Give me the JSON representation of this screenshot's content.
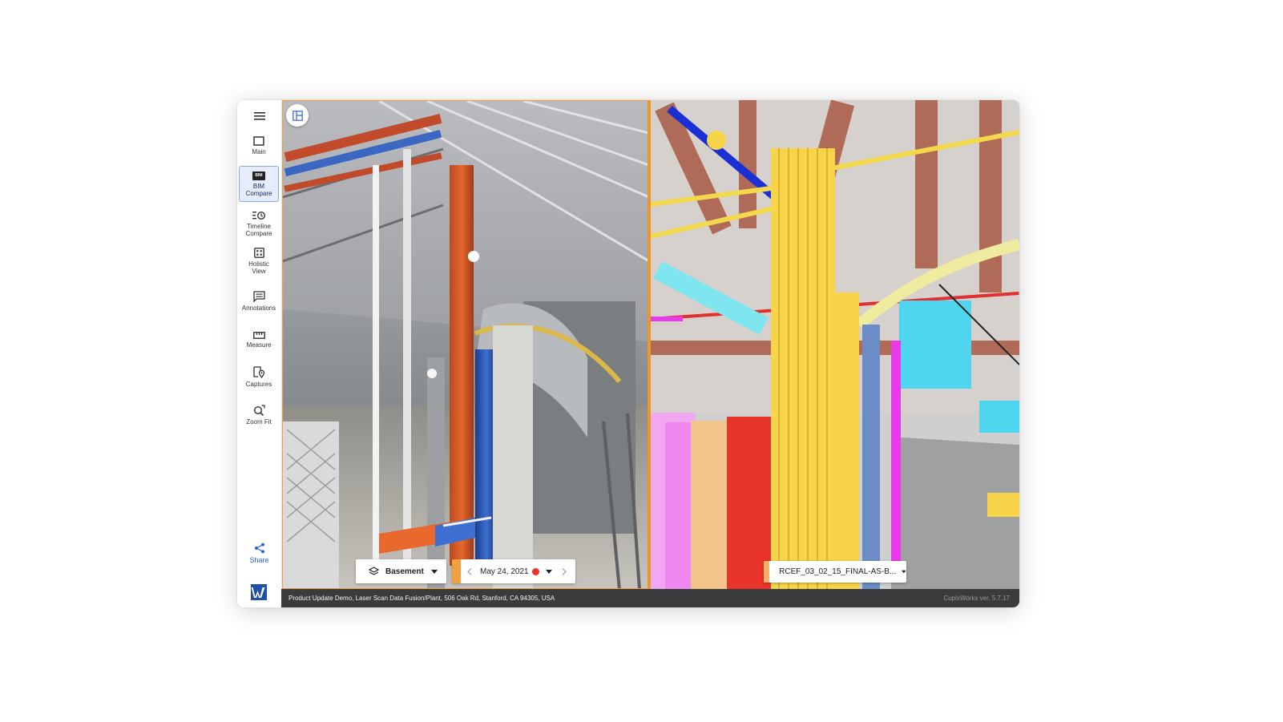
{
  "sidebar": {
    "items": [
      {
        "label": "Main",
        "icon": "square-icon",
        "active": false
      },
      {
        "label": "BIM\nCompare",
        "icon": "bim-icon",
        "active": true
      },
      {
        "label": "Timeline\nCompare",
        "icon": "timeline-icon",
        "active": false
      },
      {
        "label": "Holistic\nView",
        "icon": "grid-icon",
        "active": false
      },
      {
        "label": "Annotations",
        "icon": "annotation-icon",
        "active": false
      },
      {
        "label": "Measure",
        "icon": "ruler-icon",
        "active": false
      },
      {
        "label": "Captures",
        "icon": "capture-pin-icon",
        "active": false
      },
      {
        "label": "Zoom Fit",
        "icon": "zoom-fit-icon",
        "active": false
      }
    ],
    "bim_badge": "BIM",
    "share_label": "Share"
  },
  "viewer": {
    "floor": "Basement",
    "date": "May 24, 2021",
    "bim_model": "RCEF_03_02_15_FINAL-AS-B..."
  },
  "status": {
    "location": "Product Update Demo, Laser Scan Data Fusion/Plant, 506 Oak Rd, Stanford, CA 94305, USA",
    "version": "CupixWorks ver. 5.7.17"
  },
  "colors": {
    "accent": "#f0a040",
    "share": "#2f63d6",
    "active_nav_bg": "#e6ecfa",
    "statusbar": "#3a3b3d"
  }
}
